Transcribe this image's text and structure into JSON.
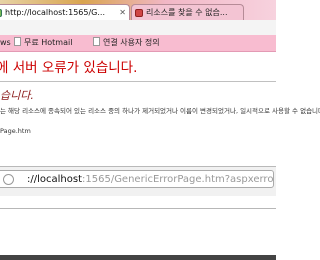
{
  "tabs": [
    {
      "title": "http://localhost:1565/G...",
      "active": true
    },
    {
      "title": "리소스를 찾을 수 없습...",
      "active": false
    }
  ],
  "bookmarks": [
    {
      "label": "ws"
    },
    {
      "label": "무료 Hotmail"
    },
    {
      "label": "연결 사용자 정의"
    }
  ],
  "error": {
    "title": "에 서버 오류가 있습니다.",
    "subtitle": "습니다.",
    "description": "는 해당 리소스에 종속되어 있는 리소스 중의 하나가 제거되었거나 이름이 변경되었거나, 일시적으로 사용할 수 없습니다.",
    "path": "Page.htm"
  },
  "address": {
    "host": "://localhost",
    "path": ":1565/GenericErrorPage.htm?aspxerrorpath=/AnyspoClientService.svc"
  },
  "colors": {
    "error_title": "#cc0000",
    "subtitle": "#8b1a1a",
    "bookmarks_bar": "#f8bcd0"
  }
}
